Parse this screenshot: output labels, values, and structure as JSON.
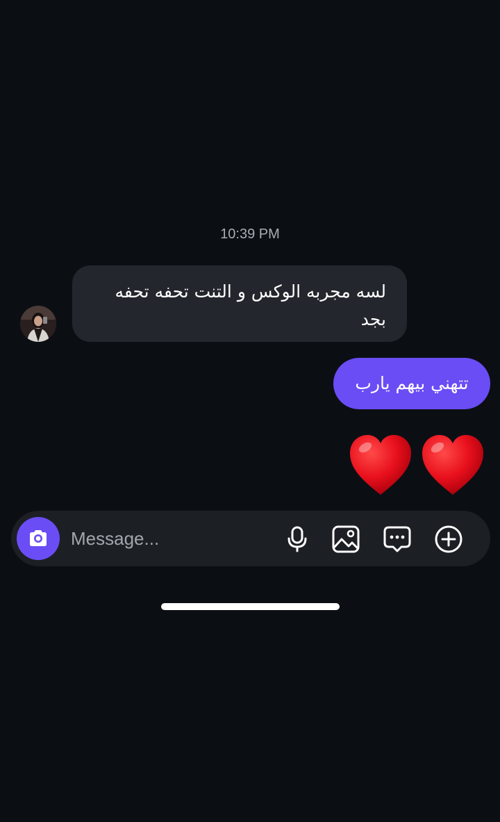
{
  "chat": {
    "timestamp": "10:39 PM",
    "messages": [
      {
        "direction": "incoming",
        "text": "لسه مجربه الوكس و التنت تحفه تحفه بجد"
      },
      {
        "direction": "outgoing",
        "text": "تتهني بيهم يارب"
      },
      {
        "direction": "outgoing",
        "text": "❤️❤️",
        "type": "emoji"
      }
    ]
  },
  "composer": {
    "placeholder": "Message...",
    "value": "",
    "icons": [
      "camera-icon",
      "microphone-icon",
      "gallery-icon",
      "sticker-icon",
      "plus-icon"
    ]
  },
  "colors": {
    "background": "#0b0f14",
    "incoming_bubble": "#23262c",
    "outgoing_bubble": "#6a4df5",
    "accent": "#6a4df5",
    "heart": "#e8101c"
  }
}
